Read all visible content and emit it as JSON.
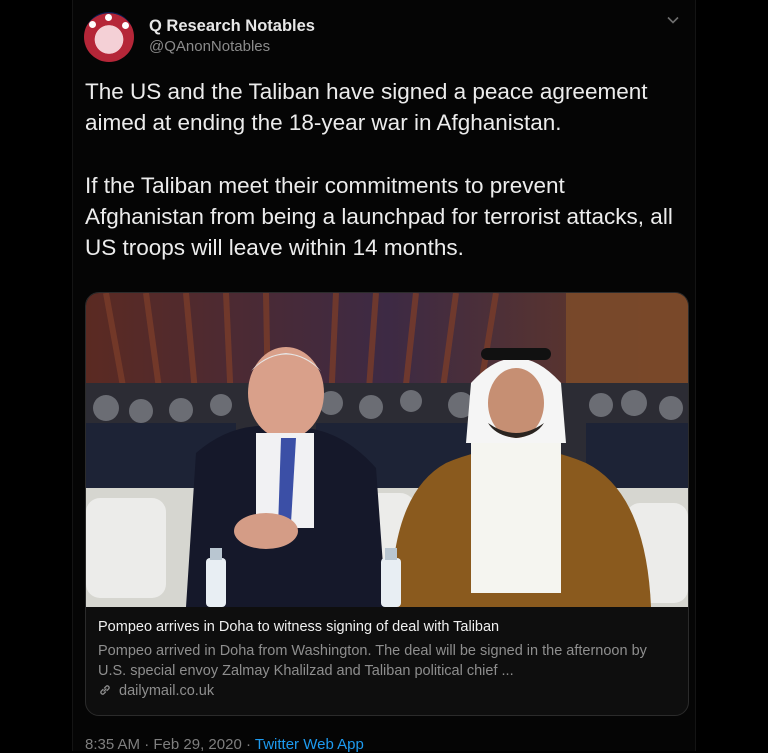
{
  "tweet": {
    "display_name": "Q Research Notables",
    "handle": "@QAnonNotables",
    "paragraph_1": "The US and the Taliban have signed a peace agreement aimed at ending the 18-year war in Afghanistan.",
    "paragraph_2": "If the Taliban meet their commitments to prevent Afghanistan from being a launchpad for terrorist attacks, all US troops will leave within 14 months.",
    "caret_icon": "chevron-down-icon"
  },
  "card": {
    "title": "Pompeo arrives in Doha to witness signing of deal with Taliban",
    "description": "Pompeo arrived in Doha from Washington. The deal will be signed in the afternoon by U.S. special envoy Zalmay Khalilzad and Taliban political chief ...",
    "domain": "dailymail.co.uk",
    "link_icon": "link-icon"
  },
  "footer": {
    "time": "8:35 AM",
    "separator": "·",
    "date": "Feb 29, 2020",
    "source": "Twitter Web App"
  },
  "colors": {
    "background": "#000000",
    "link": "#1d9bf0",
    "secondary_text": "#8e8e8e"
  }
}
